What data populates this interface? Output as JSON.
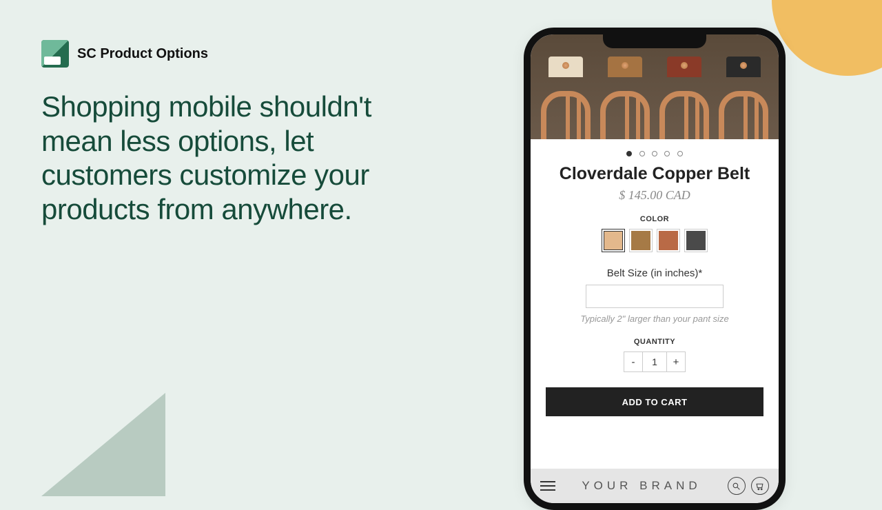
{
  "brand": {
    "name": "SC Product Options"
  },
  "headline": "Shopping mobile shouldn't mean less options, let customers customize your products from anywhere.",
  "product": {
    "title": "Cloverdale Copper Belt",
    "price": "$ 145.00 CAD",
    "carousel": {
      "count": 5,
      "active": 0
    },
    "color": {
      "label": "COLOR",
      "swatches": [
        "#e3b88c",
        "#a67a46",
        "#b96a46",
        "#4a4a4a"
      ],
      "selected": 0
    },
    "size": {
      "label": "Belt Size (in inches)*",
      "value": "",
      "hint": "Typically 2\" larger than your pant size"
    },
    "quantity": {
      "label": "QUANTITY",
      "value": "1",
      "minus": "-",
      "plus": "+"
    },
    "cta": "ADD TO CART"
  },
  "footer": {
    "brand": "YOUR BRAND"
  }
}
